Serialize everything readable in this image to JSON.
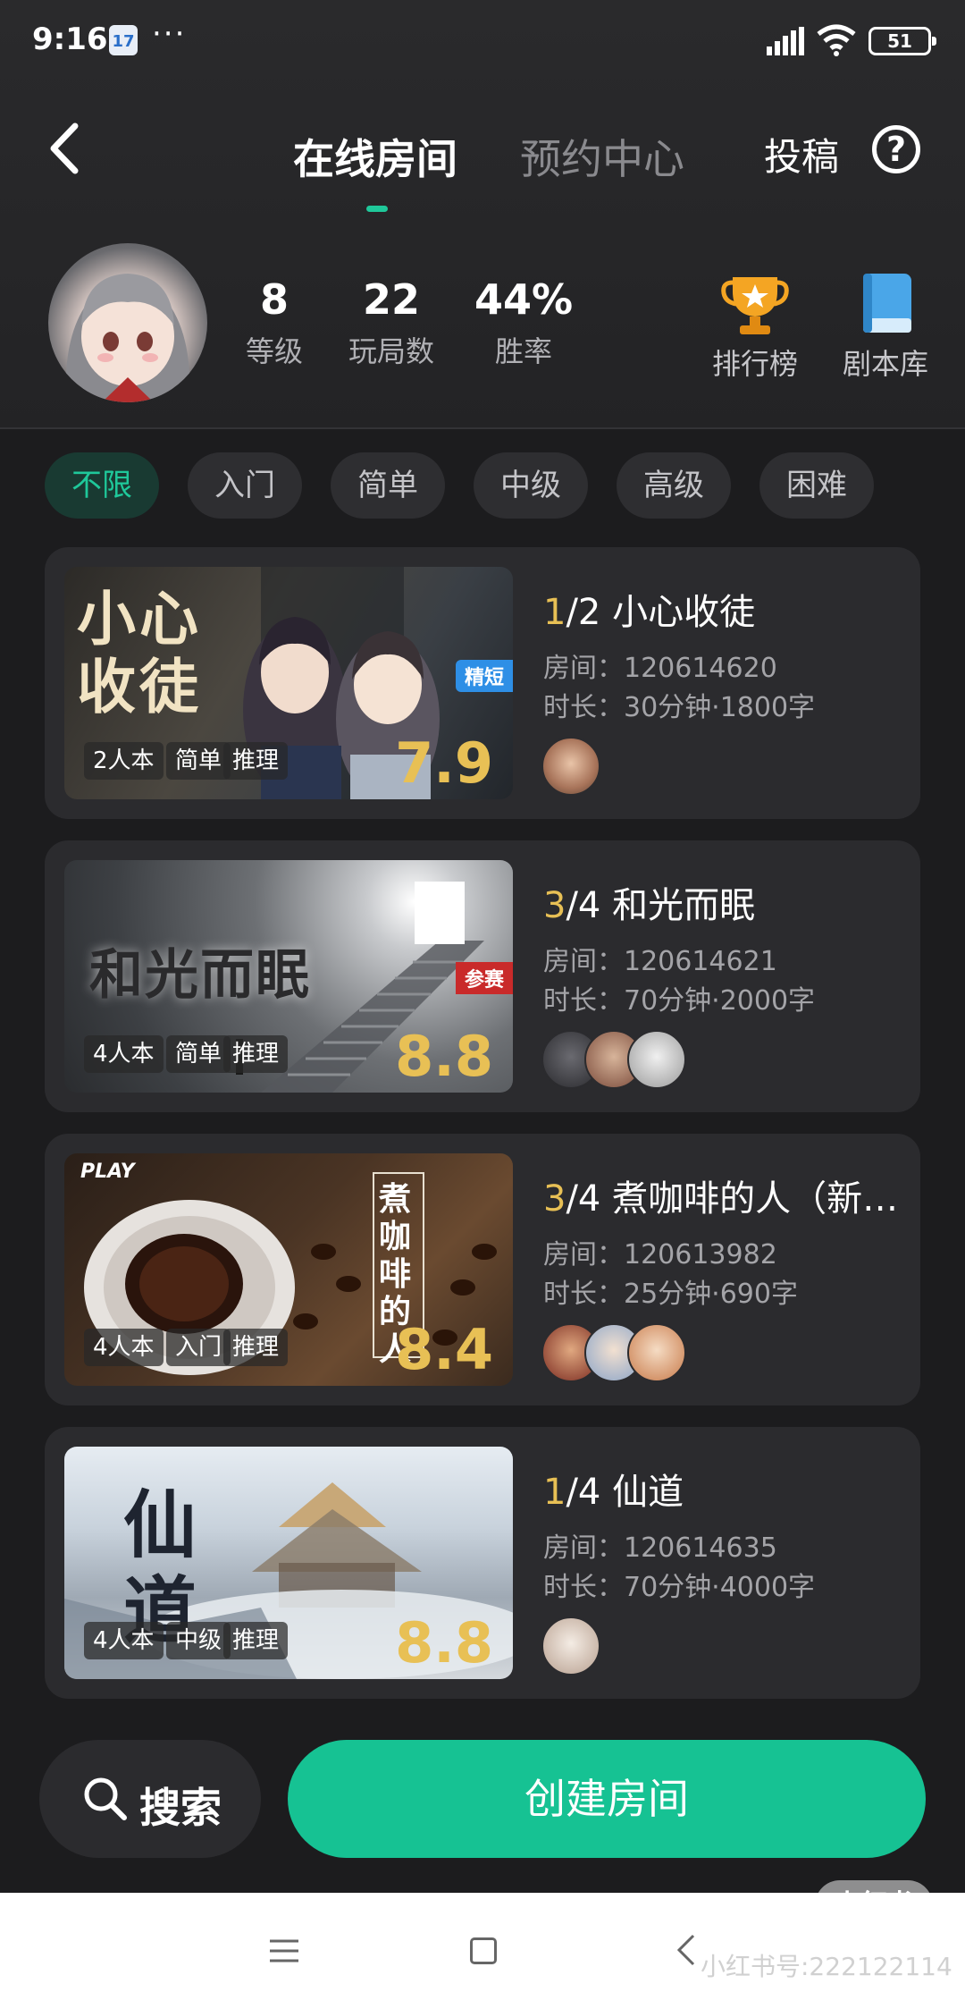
{
  "status_bar": {
    "time": "9:16",
    "calendar_day": "17",
    "more": "···",
    "battery": "51"
  },
  "header": {
    "tabs": [
      {
        "label": "在线房间",
        "active": true
      },
      {
        "label": "预约中心",
        "active": false
      }
    ],
    "submit_label": "投稿",
    "help_symbol": "?"
  },
  "profile": {
    "stats": [
      {
        "value": "8",
        "label": "等级"
      },
      {
        "value": "22",
        "label": "玩局数"
      },
      {
        "value": "44%",
        "label": "胜率"
      }
    ],
    "quick_links": [
      {
        "label": "排行榜",
        "icon": "trophy-icon"
      },
      {
        "label": "剧本库",
        "icon": "book-icon"
      }
    ]
  },
  "filters": [
    {
      "label": "不限",
      "active": true
    },
    {
      "label": "入门",
      "active": false
    },
    {
      "label": "简单",
      "active": false
    },
    {
      "label": "中级",
      "active": false
    },
    {
      "label": "高级",
      "active": false
    },
    {
      "label": "困难",
      "active": false
    }
  ],
  "rooms": [
    {
      "cover_text": "小心收徒",
      "badge": "精短",
      "tags": [
        "2人本",
        "简单",
        "推理"
      ],
      "score": "7.9",
      "current": "1",
      "capacity": "/2",
      "title": "小心收徒",
      "room": "房间：120614620",
      "duration": "时长：30分钟·1800字",
      "players": 1
    },
    {
      "cover_text": "和光而眠",
      "badge": "参赛",
      "tags": [
        "4人本",
        "简单",
        "推理"
      ],
      "score": "8.8",
      "current": "3",
      "capacity": "/4",
      "title": "和光而眠",
      "room": "房间：120614621",
      "duration": "时长：70分钟·2000字",
      "players": 3
    },
    {
      "cover_text": "煮咖啡的人",
      "badge": "PLAY",
      "tags": [
        "4人本",
        "入门",
        "推理"
      ],
      "score": "8.4",
      "current": "3",
      "capacity": "/4",
      "title": "煮咖啡的人（新…",
      "room": "房间：120613982",
      "duration": "时长：25分钟·690字",
      "players": 3
    },
    {
      "cover_text": "仙道",
      "badge": "",
      "tags": [
        "4人本",
        "中级",
        "推理"
      ],
      "score": "8.8",
      "current": "1",
      "capacity": "/4",
      "title": "仙道",
      "room": "房间：120614635",
      "duration": "时长：70分钟·4000字",
      "players": 1
    }
  ],
  "actions": {
    "search_label": "搜索",
    "create_label": "创建房间"
  },
  "watermark": {
    "logo": "小红书",
    "id": "小红书号:222122114"
  },
  "colors": {
    "accent": "#16c293",
    "score": "#e8c055",
    "background": "#1c1c1e",
    "card": "#2b2b2e"
  }
}
